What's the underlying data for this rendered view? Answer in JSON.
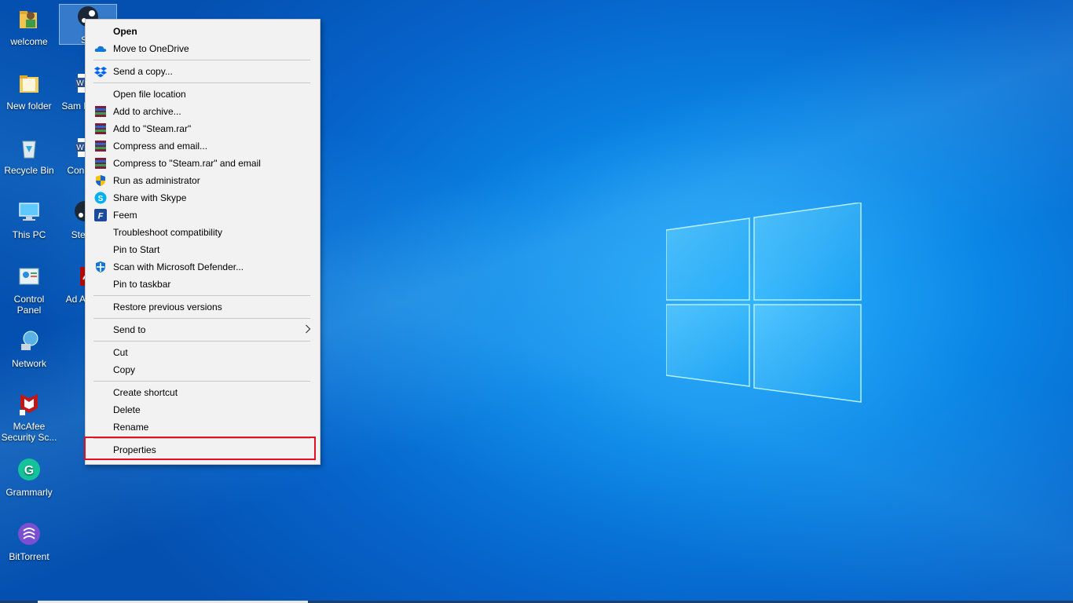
{
  "desktop": {
    "icons": [
      {
        "label": "welcome",
        "icon": "user-folder-icon"
      },
      {
        "label": "New folder",
        "icon": "folder-icon"
      },
      {
        "label": "Recycle Bin",
        "icon": "recycle-bin-icon"
      },
      {
        "label": "This PC",
        "icon": "computer-icon"
      },
      {
        "label": "Control Panel",
        "icon": "control-panel-icon"
      },
      {
        "label": "Network",
        "icon": "network-icon"
      },
      {
        "label": "McAfee Security Sc...",
        "icon": "mcafee-icon"
      },
      {
        "label": "Grammarly",
        "icon": "grammarly-icon"
      },
      {
        "label": "BitTorrent",
        "icon": "bittorrent-icon"
      }
    ],
    "icons_col2": [
      {
        "label": "Ste",
        "icon": "steam-icon"
      },
      {
        "label": "Sam Linkin",
        "icon": "word-doc-icon"
      },
      {
        "label": "Con Met",
        "icon": "word-doc-icon"
      },
      {
        "label": "Steam",
        "icon": "steam-icon"
      },
      {
        "label": "Ad Acrob",
        "icon": "acrobat-icon"
      }
    ]
  },
  "context_menu": {
    "items": [
      {
        "label": "Open",
        "icon": ""
      },
      {
        "label": "Move to OneDrive",
        "icon": "onedrive-icon"
      },
      {
        "label": "Send a copy...",
        "icon": "dropbox-icon"
      },
      {
        "label": "Open file location",
        "icon": ""
      },
      {
        "label": "Add to archive...",
        "icon": "winrar-icon"
      },
      {
        "label": "Add to \"Steam.rar\"",
        "icon": "winrar-icon"
      },
      {
        "label": "Compress and email...",
        "icon": "winrar-icon"
      },
      {
        "label": "Compress to \"Steam.rar\" and email",
        "icon": "winrar-icon"
      },
      {
        "label": "Run as administrator",
        "icon": "uac-shield-icon"
      },
      {
        "label": "Share with Skype",
        "icon": "skype-icon"
      },
      {
        "label": "Feem",
        "icon": "feem-icon"
      },
      {
        "label": "Troubleshoot compatibility",
        "icon": ""
      },
      {
        "label": "Pin to Start",
        "icon": ""
      },
      {
        "label": "Scan with Microsoft Defender...",
        "icon": "defender-icon"
      },
      {
        "label": "Pin to taskbar",
        "icon": ""
      },
      {
        "label": "Restore previous versions",
        "icon": ""
      },
      {
        "label": "Send to",
        "icon": ""
      },
      {
        "label": "Cut",
        "icon": ""
      },
      {
        "label": "Copy",
        "icon": ""
      },
      {
        "label": "Create shortcut",
        "icon": ""
      },
      {
        "label": "Delete",
        "icon": ""
      },
      {
        "label": "Rename",
        "icon": ""
      },
      {
        "label": "Properties",
        "icon": ""
      }
    ],
    "highlight_color": "#e0121f"
  },
  "colors": {
    "menu_bg": "#f2f2f2",
    "desktop_accent": "#0a86e6"
  }
}
